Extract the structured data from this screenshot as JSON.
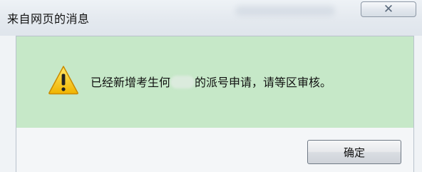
{
  "dialog": {
    "title": "来自网页的消息",
    "close_label": "✕",
    "icon": "warning-icon",
    "message_before": "已经新增考生何",
    "message_after": "的派号申请，请等区审核。",
    "ok_label": "确定"
  },
  "colors": {
    "panel_bg": "#c6e8c8",
    "warning_yellow": "#f5c400"
  }
}
